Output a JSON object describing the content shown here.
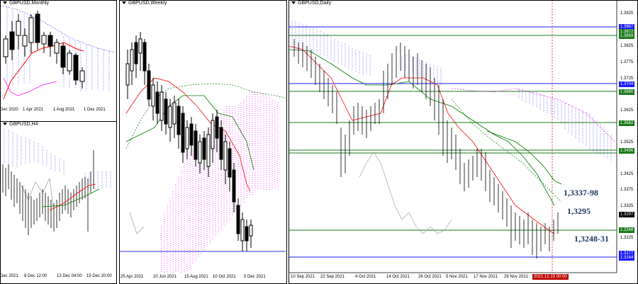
{
  "panes": {
    "monthly": {
      "title": "GBPUSD,Monthly",
      "x_labels": [
        "Dec 2020",
        "1 Apr 2021",
        "1 Aug 2021",
        "1 Dec 2021"
      ]
    },
    "h4": {
      "title": "GBPUSD,H4",
      "x_labels": [
        "Dec 2021",
        "8 Dec 12:00",
        "13 Dec 04:00",
        "15 Dec 20:00"
      ]
    },
    "weekly": {
      "title": "GBPUSD,Weekly",
      "x_labels": [
        "25 Apr 2021",
        "20 Jun 2021",
        "15 Aug 2021",
        "10 Oct 2021",
        "5 Dec 2021"
      ]
    },
    "daily": {
      "title": "GBPUSD,Daily",
      "x_labels": [
        "10 Sep 2021",
        "22 Sep 2021",
        "4 Oct 2021",
        "14 Oct 2021",
        "26 Oct 2021",
        "5 Nov 2021",
        "17 Nov 2021",
        "29 Nov 2021",
        "9 Dec 2021"
      ],
      "current_time_tag": "2021.12.15 00:00",
      "price_scale": [
        "1.3925",
        "1.3875",
        "1.3825",
        "1.3775",
        "1.3725",
        "1.3675",
        "1.3625",
        "1.3575",
        "1.3525",
        "1.3475",
        "1.3425",
        "1.3375",
        "1.3325",
        "1.3275",
        "1.3225",
        "1.3175"
      ],
      "level_tags": [
        {
          "text": "1.3887",
          "color": "#1a1aff"
        },
        {
          "text": "1.3872",
          "color": "#1a7a1a"
        },
        {
          "text": "1.3859",
          "color": "#1a7a1a"
        },
        {
          "text": "1.3704",
          "color": "#1a1aff"
        },
        {
          "text": "1.3680",
          "color": "#1a7a1a"
        },
        {
          "text": "1.3582",
          "color": "#1a7a1a"
        },
        {
          "text": "1.3496",
          "color": "#1a7a1a"
        },
        {
          "text": "1.3297",
          "color": "#000000"
        },
        {
          "text": "1.3248",
          "color": "#1a7a1a"
        },
        {
          "text": "1.3177",
          "color": "#1a1aff"
        },
        {
          "text": "1.3164",
          "color": "#1a1aff"
        }
      ],
      "annotations": {
        "upper": "1,3337-98",
        "middle": "1,3295",
        "lower": "1,3248-31"
      }
    }
  },
  "colors": {
    "tenkan": "#ff0000",
    "kijun": "#007a00",
    "cloud_bear": "#3030ff",
    "cloud_bull": "#ff00ff",
    "annotation": "#1f3864",
    "time_marker": "#c00000"
  }
}
